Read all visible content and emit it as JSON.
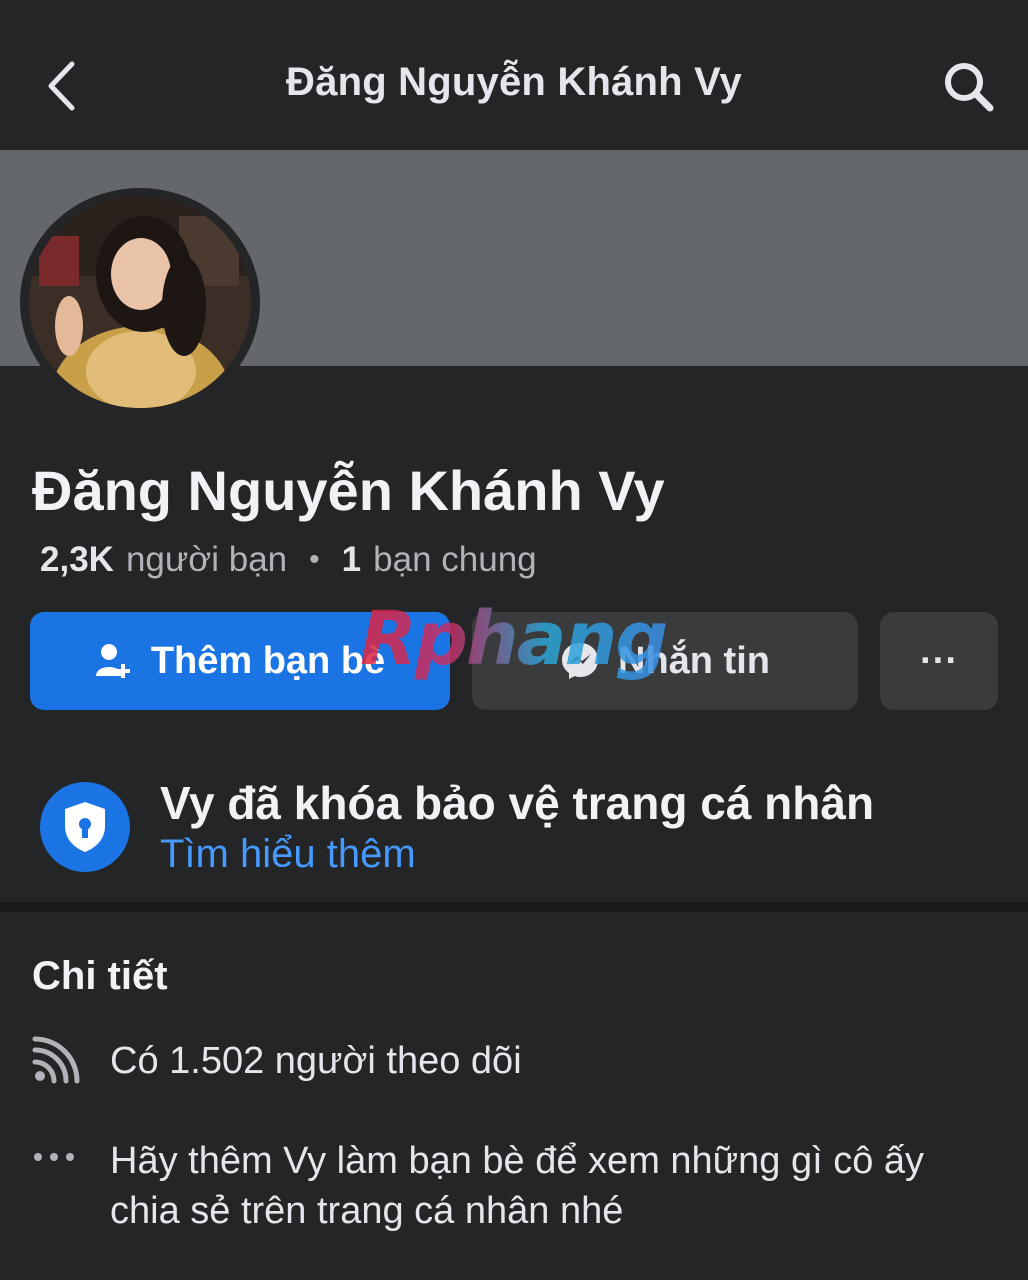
{
  "header": {
    "title": "Đăng Nguyễn Khánh Vy",
    "back_icon": "chevron-left-icon",
    "search_icon": "search-icon"
  },
  "profile": {
    "name": "Đăng Nguyễn Khánh Vy",
    "friends_count": "2,3K",
    "friends_label": "người bạn",
    "separator": "•",
    "mutual_count": "1",
    "mutual_label": "bạn chung"
  },
  "actions": {
    "add_friend_label": "Thêm bạn bè",
    "add_friend_icon": "add-person-icon",
    "message_label": "Nhắn tin",
    "message_icon": "messenger-icon",
    "more_label": "···"
  },
  "watermark": "Rphang",
  "lock_notice": {
    "title": "Vy đã khóa bảo vệ trang cá nhân",
    "link": "Tìm hiểu thêm",
    "icon": "shield-lock-icon"
  },
  "details": {
    "title": "Chi tiết",
    "items": [
      {
        "icon": "rss-icon",
        "text": "Có 1.502 người theo dõi"
      },
      {
        "icon": "more-dots-icon",
        "text": "Hãy thêm Vy làm bạn bè để xem những gì cô ấy chia sẻ trên trang cá nhân nhé"
      }
    ]
  },
  "colors": {
    "background": "#242526",
    "cover": "#64676b",
    "accent": "#1b74e4",
    "link": "#4599ff",
    "secondary_button": "#3a3b3c"
  }
}
